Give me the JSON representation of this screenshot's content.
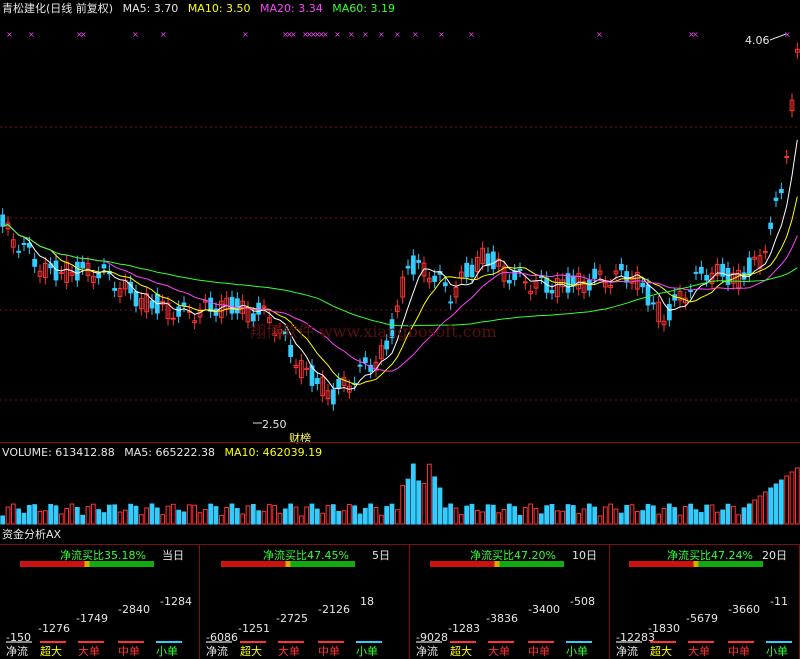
{
  "header": {
    "stock_name": "青松建化(日线 前复权)",
    "ma5": "MA5: 3.70",
    "ma10": "MA10: 3.50",
    "ma20": "MA20: 3.34",
    "ma60": "MA60: 3.19"
  },
  "price_chart": {
    "high_marker": "4.06",
    "low_marker": "2.50",
    "event_label": "财榜",
    "watermark": "翔博软件 www.xiangbosoft.com"
  },
  "volume": {
    "label": "VOLUME: 613412.88",
    "ma5": "MA5: 665222.38",
    "ma10": "MA10: 462039.19"
  },
  "capital": {
    "title": "资金分析AX",
    "legend": {
      "net": "净流",
      "xl": "超大",
      "l": "大单",
      "m": "中单",
      "s": "小单"
    },
    "panels": [
      {
        "title": "净流买比35.18%",
        "period": "当日",
        "net": "-150",
        "xl": "-1276",
        "l": "-1749",
        "m": "-2840",
        "s": "-1284"
      },
      {
        "title": "净流买比47.45%",
        "period": "5日",
        "net": "-6086",
        "xl": "-1251",
        "l": "-2725",
        "m": "-2126",
        "s": "18"
      },
      {
        "title": "净流买比47.20%",
        "period": "10日",
        "net": "-9028",
        "xl": "-1283",
        "l": "-3836",
        "m": "-3400",
        "s": "-508"
      },
      {
        "title": "净流买比47.24%",
        "period": "20日",
        "net": "-12283",
        "xl": "-1830",
        "l": "-5679",
        "m": "-3660",
        "s": "-11"
      }
    ]
  },
  "colors": {
    "background": "#000000",
    "up": "#ff3333",
    "down": "#33ccff",
    "ma5": "#ffffff",
    "ma10": "#ffff00",
    "ma20": "#ff44ff",
    "ma60": "#33ff33",
    "grid": "#7a1010"
  }
}
